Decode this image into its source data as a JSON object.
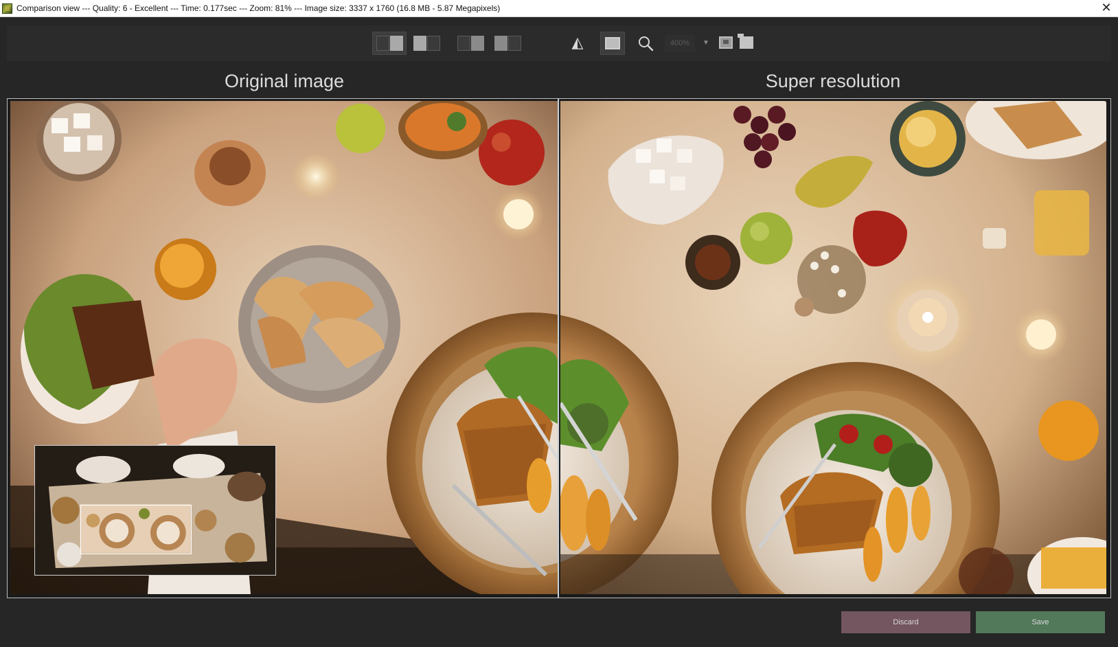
{
  "window": {
    "title": "Comparison view --- Quality: 6 - Excellent --- Time: 0.177sec --- Zoom: 81% --- Image size: 3337 x 1760 (16.8 MB - 5.87 Megapixels)",
    "close_glyph": "✕"
  },
  "toolbar": {
    "view_modes": [
      "side-by-side",
      "split",
      "single-left",
      "single-right"
    ],
    "active_view_mode": "side-by-side",
    "zoom_value": "400%",
    "zoom_dropdown_glyph": "▼",
    "mirror_glyph": "◭"
  },
  "panes": {
    "left_title": "Original image",
    "right_title": "Super resolution"
  },
  "buttons": {
    "discard": "Discard",
    "save": "Save"
  },
  "colors": {
    "background": "#262626",
    "discard": "#735660",
    "save": "#52795a",
    "divider": "#c9d3da"
  }
}
